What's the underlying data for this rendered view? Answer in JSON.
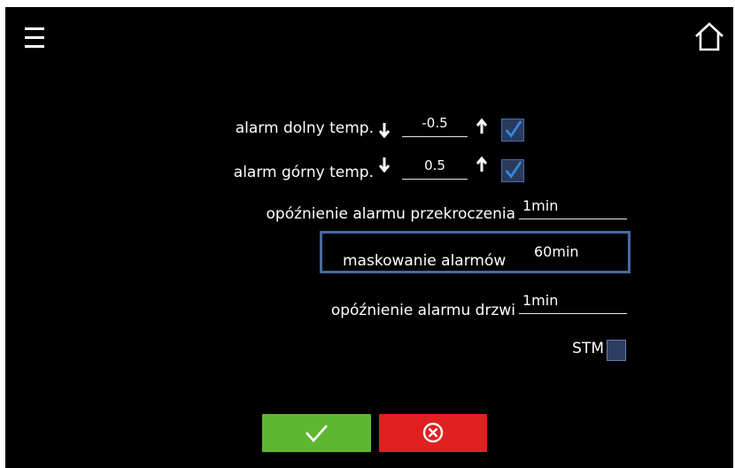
{
  "header": {
    "menu_icon": "hamburger-menu-icon",
    "home_icon": "home-icon"
  },
  "alarms": {
    "low_temp": {
      "label": "alarm dolny temp.",
      "value": "-0.5",
      "checked": true
    },
    "high_temp": {
      "label": "alarm górny temp.",
      "value": "0.5",
      "checked": true
    },
    "exceed_delay": {
      "label": "opóźnienie alarmu przekroczenia",
      "value": "1min"
    },
    "masking": {
      "label": "maskowanie alarmów",
      "value": "60min"
    },
    "door_delay": {
      "label": "opóźnienie alarmu drzwi",
      "value": "1min"
    },
    "stm": {
      "label": "STM",
      "checked": false
    }
  },
  "footer": {
    "confirm_icon": "checkmark-icon",
    "cancel_icon": "circle-x-icon"
  },
  "colors": {
    "background": "#000000",
    "confirm": "#5fb731",
    "cancel": "#e02020",
    "checkbox": "#2a3a5c",
    "highlight_border": "#4a6a9e",
    "check": "#2f8be0"
  }
}
